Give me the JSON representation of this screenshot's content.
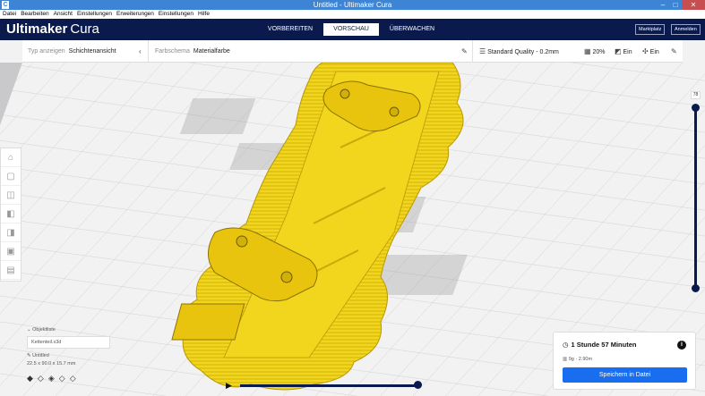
{
  "window": {
    "title": "Untitled - Ultimaker Cura"
  },
  "menu": [
    "Datei",
    "Bearbeiten",
    "Ansicht",
    "Einstellungen",
    "Erweiterungen",
    "Einstellungen",
    "Hilfe"
  ],
  "header": {
    "logo_bold": "Ultimaker",
    "logo_light": "Cura",
    "stages": [
      "VORBEREITEN",
      "VORSCHAU",
      "ÜBERWACHEN"
    ],
    "active_stage": "VORSCHAU",
    "marketplace": "Marktplatz",
    "signin": "Anmelden"
  },
  "toolbar": {
    "view_type_label": "Typ anzeigen",
    "view_type_value": "Schichtenansicht",
    "color_scheme_label": "Farbschema",
    "color_scheme_value": "Materialfarbe",
    "quality": "Standard Quality - 0.2mm",
    "infill": "20%",
    "support": "Ein",
    "adhesion": "Ein"
  },
  "object": {
    "list_label": "Objektliste",
    "file_name": "Kettenteil.x3d",
    "project": "Untitled",
    "dimensions": "22.5 x 90.0 x 15.7 mm"
  },
  "layers": {
    "current": "78",
    "top_fraction": 1.0,
    "bottom_fraction": 0.0
  },
  "print": {
    "time": "1 Stunde 57 Minuten",
    "material": "9g · 2.90m",
    "save_button": "Speichern in Datei"
  },
  "colors": {
    "header": "#0b1a4d",
    "model": "#f2d51d",
    "accent": "#196ef0"
  }
}
